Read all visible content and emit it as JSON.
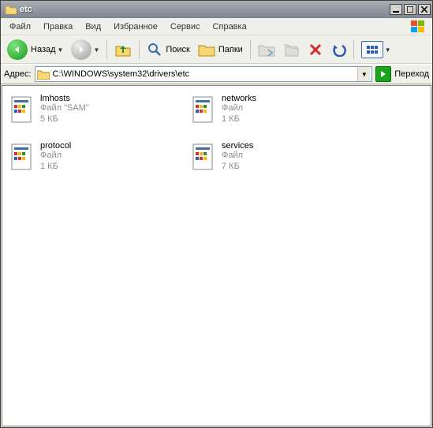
{
  "window": {
    "title": "etc"
  },
  "menu": {
    "file": "Файл",
    "edit": "Правка",
    "view": "Вид",
    "favorites": "Избранное",
    "tools": "Сервис",
    "help": "Справка"
  },
  "toolbar": {
    "back": "Назад",
    "search": "Поиск",
    "folders": "Папки"
  },
  "address": {
    "label": "Адрес:",
    "path": "C:\\WINDOWS\\system32\\drivers\\etc",
    "go": "Переход"
  },
  "files": [
    {
      "name": "lmhosts",
      "type": "Файл \"SAM\"",
      "size": "5 КБ"
    },
    {
      "name": "networks",
      "type": "Файл",
      "size": "1 КБ"
    },
    {
      "name": "protocol",
      "type": "Файл",
      "size": "1 КБ"
    },
    {
      "name": "services",
      "type": "Файл",
      "size": "7 КБ"
    }
  ]
}
